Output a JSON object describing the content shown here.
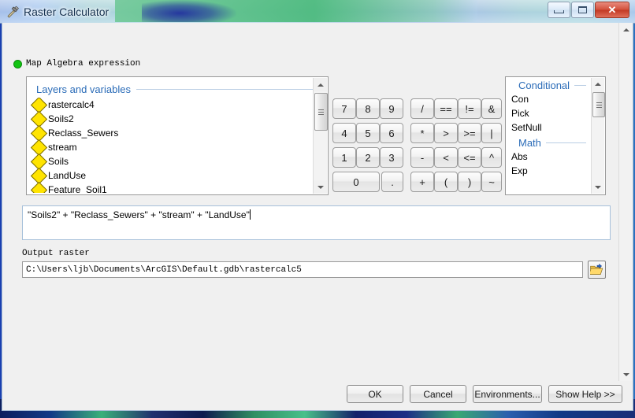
{
  "window": {
    "title": "Raster Calculator",
    "icon": "hammer-tool-icon",
    "minimize_label": "Minimize",
    "maximize_label": "Maximize",
    "close_label": "Close",
    "close_glyph": "✕"
  },
  "section": {
    "label": "Map Algebra expression",
    "status_color": "#12c412"
  },
  "layers_panel": {
    "legend": "Layers and variables",
    "items": [
      {
        "name": "rastercalc4",
        "icon": "raster-layer-icon"
      },
      {
        "name": "Soils2",
        "icon": "raster-layer-icon"
      },
      {
        "name": "Reclass_Sewers",
        "icon": "raster-layer-icon"
      },
      {
        "name": "stream",
        "icon": "raster-layer-icon"
      },
      {
        "name": "Soils",
        "icon": "raster-layer-icon"
      },
      {
        "name": "LandUse",
        "icon": "raster-layer-icon"
      },
      {
        "name": "Feature_Soil1",
        "icon": "raster-layer-icon"
      }
    ]
  },
  "keypad": {
    "keys": [
      {
        "label": "7",
        "name": "key-7"
      },
      {
        "label": "8",
        "name": "key-8"
      },
      {
        "label": "9",
        "name": "key-9"
      },
      {
        "label": "/",
        "name": "key-divide"
      },
      {
        "label": "==",
        "name": "key-equal-equal"
      },
      {
        "label": "!=",
        "name": "key-not-equal"
      },
      {
        "label": "&",
        "name": "key-bitwise-and"
      },
      {
        "label": "4",
        "name": "key-4"
      },
      {
        "label": "5",
        "name": "key-5"
      },
      {
        "label": "6",
        "name": "key-6"
      },
      {
        "label": "*",
        "name": "key-multiply"
      },
      {
        "label": ">",
        "name": "key-greater-than"
      },
      {
        "label": ">=",
        "name": "key-greater-equal"
      },
      {
        "label": "|",
        "name": "key-bitwise-or"
      },
      {
        "label": "1",
        "name": "key-1"
      },
      {
        "label": "2",
        "name": "key-2"
      },
      {
        "label": "3",
        "name": "key-3"
      },
      {
        "label": "-",
        "name": "key-minus"
      },
      {
        "label": "<",
        "name": "key-less-than"
      },
      {
        "label": "<=",
        "name": "key-less-equal"
      },
      {
        "label": "^",
        "name": "key-power"
      },
      {
        "label": "0",
        "name": "key-0"
      },
      {
        "label": ".",
        "name": "key-decimal-point"
      },
      {
        "label": "+",
        "name": "key-plus"
      },
      {
        "label": "(",
        "name": "key-open-paren"
      },
      {
        "label": ")",
        "name": "key-close-paren"
      },
      {
        "label": "~",
        "name": "key-bitwise-not"
      }
    ]
  },
  "functions_panel": {
    "groups": [
      {
        "heading": "Conditional",
        "items": [
          "Con",
          "Pick",
          "SetNull"
        ]
      },
      {
        "heading": "Math",
        "items": [
          "Abs",
          "Exp"
        ]
      }
    ]
  },
  "expression": {
    "value": "\"Soils2\" + \"Reclass_Sewers\" + \"stream\" + \"LandUse\"",
    "placeholder": ""
  },
  "output_raster": {
    "label": "Output raster",
    "value": "C:\\Users\\ljb\\Documents\\ArcGIS\\Default.gdb\\rastercalc5",
    "placeholder": "",
    "browse_icon": "open-folder-icon"
  },
  "buttons": {
    "ok": "OK",
    "cancel": "Cancel",
    "environments": "Environments...",
    "help": "Show Help >>"
  }
}
